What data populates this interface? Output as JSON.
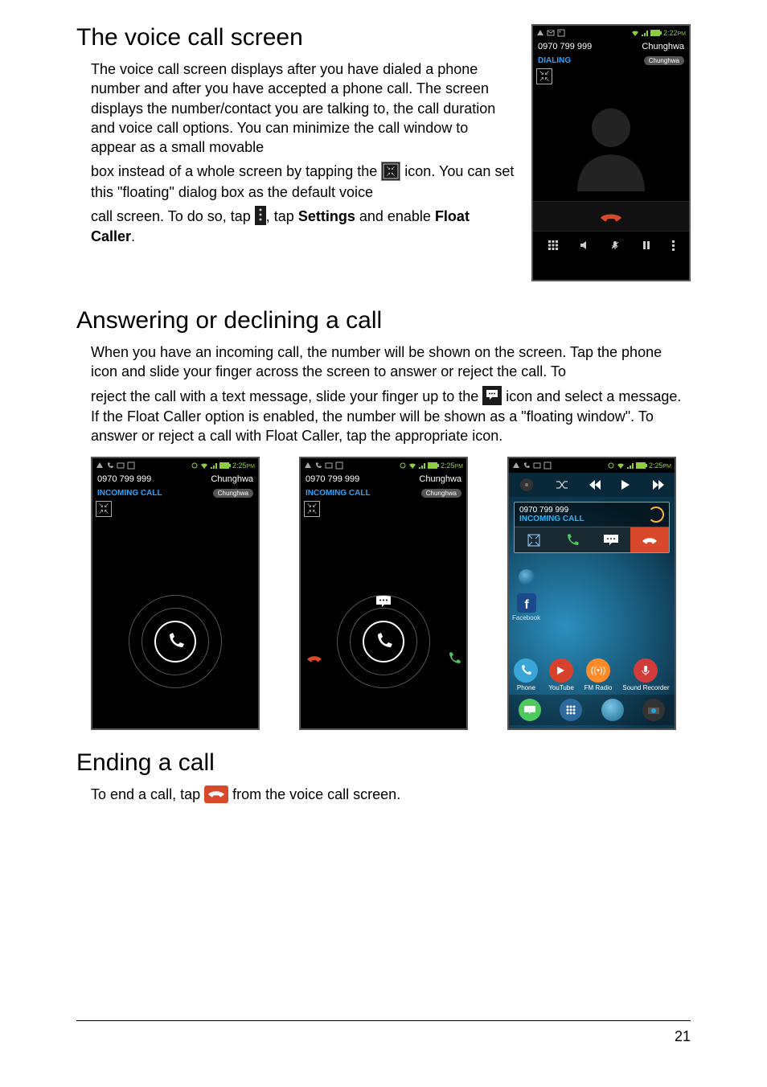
{
  "page_number": "21",
  "section1": {
    "title": "The voice call screen",
    "para_a": "The voice call screen displays after you have dialed a phone number and after you have accepted a phone call. The screen displays the number/contact you are talking to, the call duration and voice call options. You can minimize the call window to appear as a small movable",
    "para_b1": "box instead of a whole screen by tapping the ",
    "para_b2": " icon. You can set this \"floating\" dialog box as the default voice",
    "para_c1": "call screen. To do so, tap ",
    "para_c2": ", tap ",
    "para_c_bold1": "Settings",
    "para_c3": " and enable ",
    "para_c_bold2": "Float Caller",
    "para_c4": "."
  },
  "section2": {
    "title": "Answering or declining a call",
    "para_a": "When you have an incoming call, the number will be shown on the screen. Tap the phone icon and slide your finger across the screen to answer or reject the call. To",
    "para_b1": "reject the call with a text message, slide your finger up to the ",
    "para_b2": " icon and select a message. If the Float Caller option is enabled, the number will be shown as a \"floating window\". To answer or reject a call with Float Caller, tap the appropriate icon."
  },
  "section3": {
    "title": "Ending a call",
    "para_a1": "To end a call, tap ",
    "para_a2": " from the voice call screen."
  },
  "shot_top": {
    "time": "2:22",
    "time_pm": "PM",
    "number": "0970 799 999",
    "carrier": "Chunghwa",
    "status": "DIALING",
    "pill": "Chunghwa"
  },
  "shot_left": {
    "time": "2:25",
    "time_pm": "PM",
    "number": "0970 799 999",
    "carrier": "Chunghwa",
    "status": "INCOMING CALL",
    "pill": "Chunghwa"
  },
  "shot_mid": {
    "time": "2:25",
    "time_pm": "PM",
    "number": "0970 799 999",
    "carrier": "Chunghwa",
    "status": "INCOMING CALL",
    "pill": "Chunghwa"
  },
  "shot_right": {
    "time": "2:25",
    "time_pm": "PM",
    "float_number": "0970 799 999",
    "float_status": "INCOMING CALL",
    "fb_label": "Facebook",
    "apps": {
      "phone": "Phone",
      "youtube": "YouTube",
      "fmradio": "FM Radio",
      "sound": "Sound Recorder"
    }
  }
}
